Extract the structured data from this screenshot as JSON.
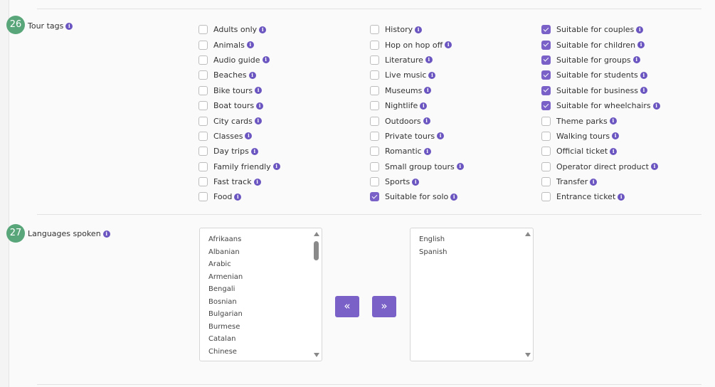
{
  "section26": {
    "number": "26",
    "label": "Tour tags",
    "columns": [
      [
        {
          "label": "Adults only",
          "checked": false
        },
        {
          "label": "Animals",
          "checked": false
        },
        {
          "label": "Audio guide",
          "checked": false
        },
        {
          "label": "Beaches",
          "checked": false
        },
        {
          "label": "Bike tours",
          "checked": false
        },
        {
          "label": "Boat tours",
          "checked": false
        },
        {
          "label": "City cards",
          "checked": false
        },
        {
          "label": "Classes",
          "checked": false
        },
        {
          "label": "Day trips",
          "checked": false
        },
        {
          "label": "Family friendly",
          "checked": false
        },
        {
          "label": "Fast track",
          "checked": false
        },
        {
          "label": "Food",
          "checked": false
        }
      ],
      [
        {
          "label": "History",
          "checked": false
        },
        {
          "label": "Hop on hop off",
          "checked": false
        },
        {
          "label": "Literature",
          "checked": false
        },
        {
          "label": "Live music",
          "checked": false
        },
        {
          "label": "Museums",
          "checked": false
        },
        {
          "label": "Nightlife",
          "checked": false
        },
        {
          "label": "Outdoors",
          "checked": false
        },
        {
          "label": "Private tours",
          "checked": false
        },
        {
          "label": "Romantic",
          "checked": false
        },
        {
          "label": "Small group tours",
          "checked": false
        },
        {
          "label": "Sports",
          "checked": false
        },
        {
          "label": "Suitable for solo",
          "checked": true
        }
      ],
      [
        {
          "label": "Suitable for couples",
          "checked": true
        },
        {
          "label": "Suitable for children",
          "checked": true
        },
        {
          "label": "Suitable for groups",
          "checked": true
        },
        {
          "label": "Suitable for students",
          "checked": true
        },
        {
          "label": "Suitable for business",
          "checked": true
        },
        {
          "label": "Suitable for wheelchairs",
          "checked": true
        },
        {
          "label": "Theme parks",
          "checked": false
        },
        {
          "label": "Walking tours",
          "checked": false
        },
        {
          "label": "Official ticket",
          "checked": false
        },
        {
          "label": "Operator direct product",
          "checked": false
        },
        {
          "label": "Transfer",
          "checked": false
        },
        {
          "label": "Entrance ticket",
          "checked": false
        }
      ]
    ]
  },
  "section27": {
    "number": "27",
    "label": "Languages spoken",
    "available": [
      "Afrikaans",
      "Albanian",
      "Arabic",
      "Armenian",
      "Bengali",
      "Bosnian",
      "Bulgarian",
      "Burmese",
      "Catalan",
      "Chinese"
    ],
    "selected": [
      "English",
      "Spanish"
    ],
    "move_left_label": "«",
    "move_right_label": "»"
  },
  "icons": {
    "info": "i"
  },
  "colors": {
    "accent": "#7a61c8",
    "badge": "#58a67a",
    "info": "#6b55c0"
  }
}
